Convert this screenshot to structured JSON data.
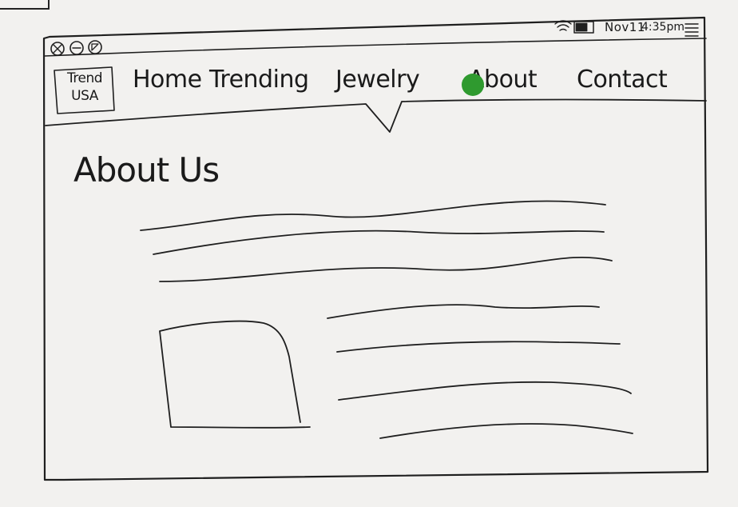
{
  "status_bar": {
    "wifi_icon": "wifi-icon",
    "battery_icon": "battery-icon",
    "date": "Nov11",
    "time": "4:35pm",
    "menu_icon": "menu-icon"
  },
  "window_controls": {
    "close_icon": "close-icon",
    "minimize_icon": "minimize-icon",
    "maximize_icon": "maximize-icon"
  },
  "logo": {
    "line1": "Trend",
    "line2": "USA"
  },
  "nav": {
    "items": [
      {
        "label": "Home"
      },
      {
        "label": "Trending"
      },
      {
        "label": "Jewelry"
      },
      {
        "label": "About"
      },
      {
        "label": "Contact"
      }
    ],
    "active": "About"
  },
  "page": {
    "title": "About Us"
  },
  "colors": {
    "cursor": "#2f9a2f",
    "ink": "#1f1f1f",
    "paper": "#f2f1ef"
  }
}
